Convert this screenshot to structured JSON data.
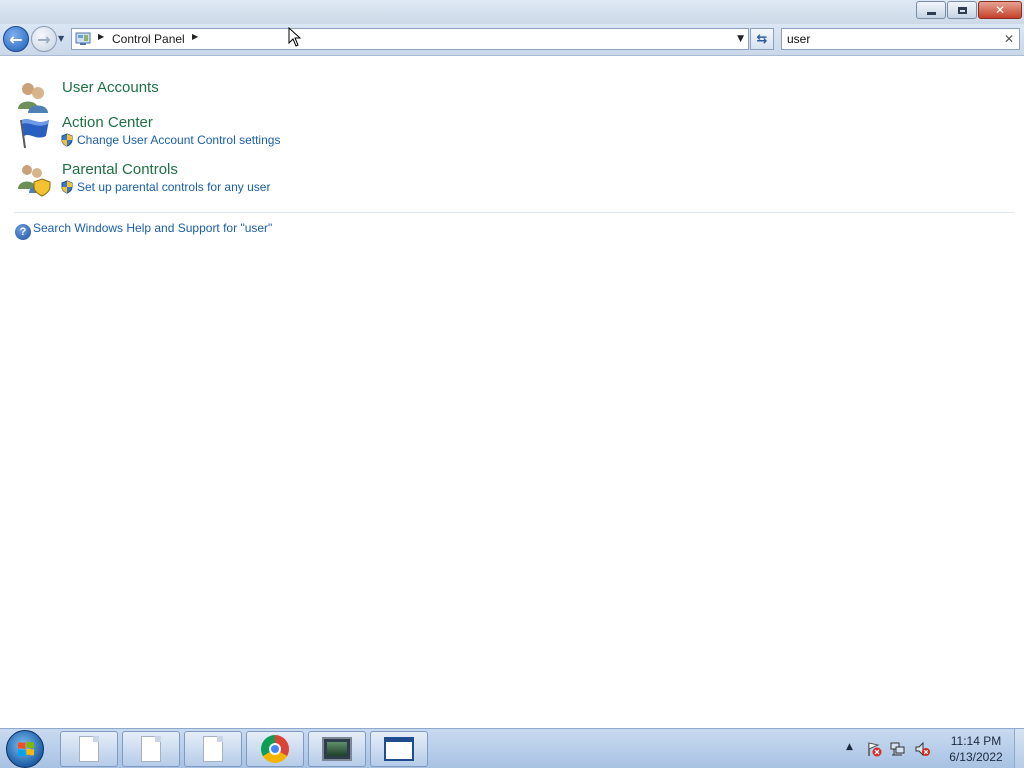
{
  "window": {
    "minimize_icon": "minimize-icon",
    "restore_icon": "restore-icon",
    "close_icon": "close-icon",
    "close_color": "#c4402a"
  },
  "navbar": {
    "back_icon": "back-arrow-icon",
    "forward_icon": "forward-arrow-icon",
    "breadcrumb": [
      "Control Panel"
    ],
    "search_value": "user",
    "refresh_icon": "refresh-icon"
  },
  "results": [
    {
      "title": "User Accounts",
      "icon": "user-accounts-icon",
      "tasks": []
    },
    {
      "title": "Action Center",
      "icon": "action-center-flag-icon",
      "tasks": [
        "Change User Account Control settings"
      ]
    },
    {
      "title": "Parental Controls",
      "icon": "parental-controls-icon",
      "tasks": [
        "Set up parental controls for any user"
      ]
    }
  ],
  "help": {
    "text": "Search Windows Help and Support for \"user\""
  },
  "colors": {
    "result_title": "#1e7145",
    "link": "#1a5ea8"
  },
  "taskbar": {
    "apps": [
      {
        "name": "document-1",
        "icon": "document-icon"
      },
      {
        "name": "document-2",
        "icon": "document-icon"
      },
      {
        "name": "document-3",
        "icon": "document-icon"
      },
      {
        "name": "chrome",
        "icon": "chrome-icon"
      },
      {
        "name": "monitor",
        "icon": "monitor-icon"
      },
      {
        "name": "window",
        "icon": "window-icon"
      }
    ],
    "clock_time": "11:14 PM",
    "clock_date": "6/13/2022"
  }
}
